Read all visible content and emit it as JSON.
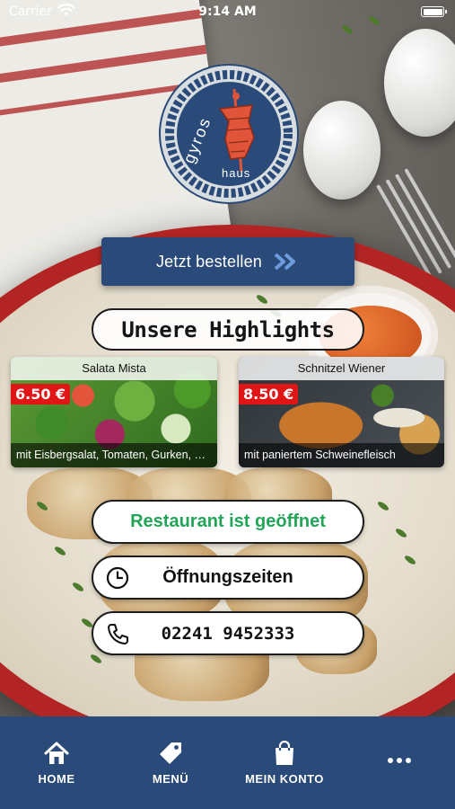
{
  "status_bar": {
    "carrier": "Carrier",
    "time": "9:14 AM"
  },
  "logo": {
    "line1": "gyros",
    "line2": "haus",
    "colors": {
      "ring": "#2a4a79",
      "accent": "#e0553a"
    }
  },
  "order_button": {
    "label": "Jetzt bestellen",
    "icon": "double-chevron-right-icon"
  },
  "highlights": {
    "title": "Unsere Highlights",
    "items": [
      {
        "name": "Salata Mista",
        "price": "6.50 €",
        "description": "mit Eisbergsalat, Tomaten, Gurken, Zwie..."
      },
      {
        "name": "Schnitzel Wiener",
        "price": "8.50 €",
        "description": "mit paniertem Schweinefleisch"
      }
    ]
  },
  "status_pill": {
    "label": "Restaurant ist geöffnet",
    "color": "#23a559"
  },
  "hours_pill": {
    "label": "Öffnungszeiten",
    "icon": "clock-icon"
  },
  "phone_pill": {
    "label": "02241 9452333",
    "icon": "phone-icon"
  },
  "tabbar": {
    "background": "#2a4a79",
    "tabs": [
      {
        "label": "HOME",
        "icon": "home-icon"
      },
      {
        "label": "MENÜ",
        "icon": "tag-icon"
      },
      {
        "label": "MEIN KONTO",
        "icon": "shopping-bag-icon"
      },
      {
        "label": "",
        "icon": "more-dots-icon"
      }
    ]
  }
}
